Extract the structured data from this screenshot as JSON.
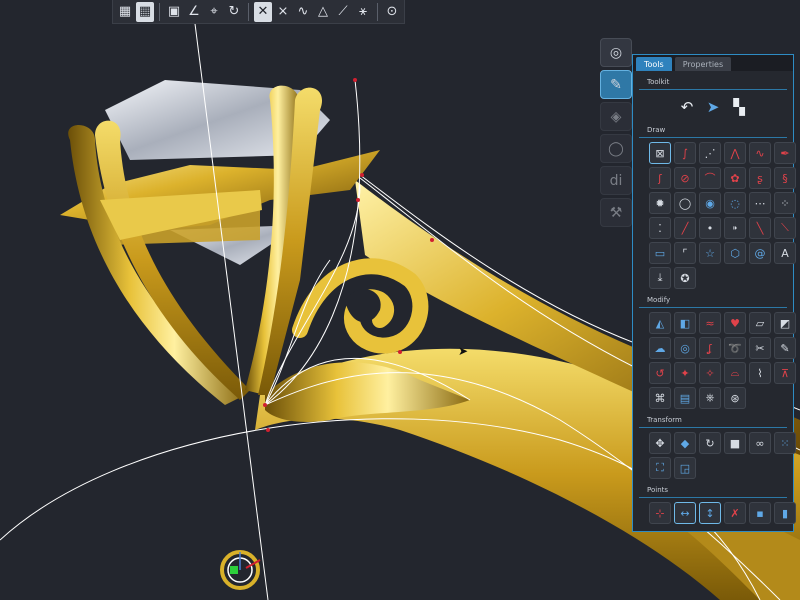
{
  "toolbar": {
    "buttons": [
      {
        "icon": "grid-icon"
      },
      {
        "icon": "grid-snap-icon",
        "active": true
      },
      {
        "icon": "sep"
      },
      {
        "icon": "layer-icon"
      },
      {
        "icon": "angle-icon"
      },
      {
        "icon": "snap-point-icon"
      },
      {
        "icon": "undo-arc-icon"
      },
      {
        "icon": "sep"
      },
      {
        "icon": "pick-icon",
        "active": true
      },
      {
        "icon": "cross-snap-icon"
      },
      {
        "icon": "curve-snap-icon"
      },
      {
        "icon": "triangle-icon"
      },
      {
        "icon": "line-snap-icon"
      },
      {
        "icon": "ray-icon"
      },
      {
        "icon": "sep"
      },
      {
        "icon": "circle-target-icon"
      }
    ]
  },
  "side_palette": [
    {
      "icon": "ring-icon",
      "selected": false
    },
    {
      "icon": "pen-draw-icon",
      "selected": true
    },
    {
      "icon": "stone-icon",
      "selected": false
    },
    {
      "icon": "render-ring-icon",
      "selected": false
    },
    {
      "icon": "di-text-icon",
      "label": "di",
      "selected": false
    },
    {
      "icon": "tool-icon",
      "selected": false
    }
  ],
  "panel": {
    "tabs": [
      "Tools",
      "Properties"
    ],
    "active_tab": "Tools",
    "sections": {
      "toolkit": "Toolkit",
      "draw": "Draw",
      "modify": "Modify",
      "transform": "Transform",
      "points": "Points"
    },
    "toolkit_icons": [
      "undo-icon",
      "cursor-icon",
      "wizard-icon"
    ],
    "draw_icons": [
      "delete-x-icon",
      "curve-icon",
      "points-curve-icon",
      "zigzag-icon",
      "wave-icon",
      "pen-tool-icon",
      "spiral-curve-icon",
      "circle-ribbon-icon",
      "arc-curve-icon",
      "flower-icon",
      "s-curve-icon",
      "helix-icon",
      "star-burst-icon",
      "gem-outline-icon",
      "circle-icon",
      "node-circle-icon",
      "dash-icon",
      "ellipsis-icon",
      "dots-icon",
      "line-icon",
      "dot-icon",
      "point-line-icon",
      "diagonal-icon",
      "diagonal-red-icon",
      "rectangle-icon",
      "corner-rect-icon",
      "star-icon",
      "hexagon-icon",
      "spiral-icon",
      "text-icon",
      "import-icon",
      "logo-icon"
    ],
    "modify_icons": [
      "boolean-icon",
      "split-icon",
      "wave-mod-icon",
      "heart-icon",
      "offset-icon",
      "erase-icon",
      "blob-icon",
      "ring-mod-icon",
      "chain-s-icon",
      "loop-icon",
      "trim-icon",
      "brush-icon",
      "refresh-icon",
      "pattern-icon",
      "pattern-red-icon",
      "fillet-icon",
      "bend-icon",
      "scale-curve-icon",
      "node-edit-icon",
      "tiles-icon",
      "stamp-icon",
      "compass-icon"
    ],
    "transform_icons": [
      "move-icon",
      "rotate-node-icon",
      "rotate-icon",
      "square-icon",
      "bow-icon",
      "dots-grid-icon",
      "frame-icon",
      "align-corner-icon"
    ],
    "points_icons": [
      "point-add-icon",
      "scale-h-icon",
      "scale-v-icon",
      "point-red-icon",
      "point-select-icon",
      "point-move-icon"
    ]
  },
  "colors": {
    "background": "#23262e",
    "accent": "#2f82bd",
    "gold": "#d9b12a",
    "curve": "#ffffff",
    "control_point": "#d02030"
  }
}
